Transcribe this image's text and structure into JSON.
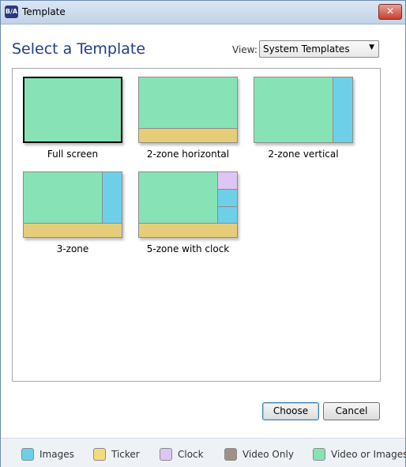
{
  "window": {
    "title": "Template",
    "app_icon_text": "B/A",
    "close_glyph": "✕"
  },
  "heading": "Select a Template",
  "view": {
    "label": "View:",
    "selected": "System Templates",
    "arrow": "▼"
  },
  "templates": [
    {
      "label": "Full screen",
      "selected": true
    },
    {
      "label": "2-zone horizontal",
      "selected": false
    },
    {
      "label": "2-zone vertical",
      "selected": false
    },
    {
      "label": "3-zone",
      "selected": false
    },
    {
      "label": "5-zone with clock",
      "selected": false
    }
  ],
  "buttons": {
    "choose": "Choose",
    "cancel": "Cancel"
  },
  "legend": [
    {
      "label": "Images",
      "color": "#6dd0e8"
    },
    {
      "label": "Ticker",
      "color": "#f3dc80"
    },
    {
      "label": "Clock",
      "color": "#ddc6f3"
    },
    {
      "label": "Video Only",
      "color": "#a28f86"
    },
    {
      "label": "Video or Images",
      "color": "#87e3b6"
    }
  ]
}
